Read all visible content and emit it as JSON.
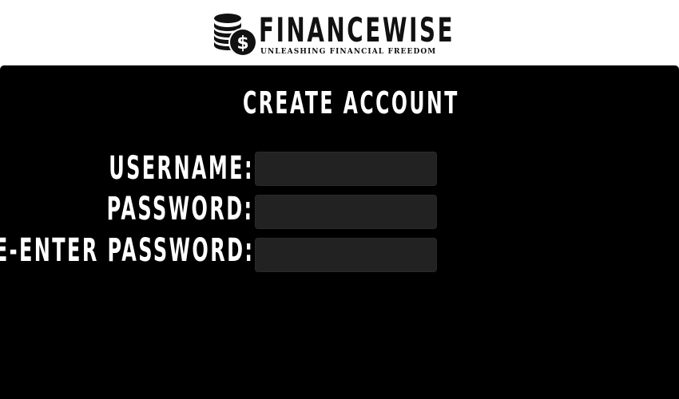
{
  "brand": {
    "name": "FINANCEWISE",
    "tagline": "UNLEASHING FINANCIAL FREEDOM",
    "logo_icon": "coin-stack-dollar-icon"
  },
  "form": {
    "title": "CREATE ACCOUNT",
    "username_label": "USERNAME:",
    "username_value": "",
    "password_label": "PASSWORD:",
    "password_value": "",
    "reenter_label": "RE-ENTER PASSWORD:",
    "reenter_value": ""
  },
  "colors": {
    "background": "#ffffff",
    "panel": "#000000",
    "field": "#222222",
    "text_light": "#ffffff",
    "text_dark": "#111111"
  }
}
